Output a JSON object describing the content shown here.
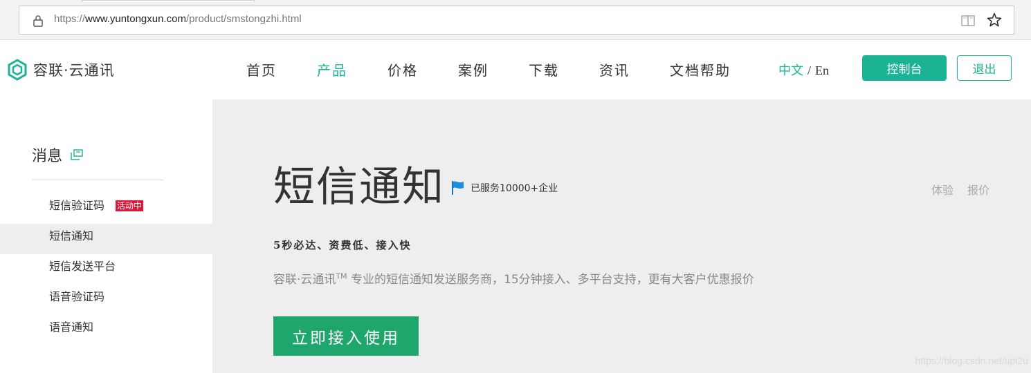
{
  "browser": {
    "url_prefix": "https://",
    "url_host": "www.yuntongxun.com",
    "url_path": "/product/smstongzhi.html"
  },
  "header": {
    "logo_text": "容联·云通讯",
    "nav": [
      {
        "label": "首页",
        "active": false
      },
      {
        "label": "产品",
        "active": true
      },
      {
        "label": "价格",
        "active": false
      },
      {
        "label": "案例",
        "active": false
      },
      {
        "label": "下载",
        "active": false
      },
      {
        "label": "资讯",
        "active": false
      },
      {
        "label": "文档帮助",
        "active": false
      }
    ],
    "lang_zh": "中文",
    "lang_sep": "/",
    "lang_en": "En",
    "console_label": "控制台",
    "logout_label": "退出"
  },
  "sidebar": {
    "title": "消息",
    "items": [
      {
        "label": "短信验证码",
        "badge": "活动中"
      },
      {
        "label": "短信通知",
        "active": true
      },
      {
        "label": "短信发送平台"
      },
      {
        "label": "语音验证码"
      },
      {
        "label": "语音通知"
      }
    ]
  },
  "hero": {
    "title": "短信通知",
    "served": "已服务10000+企业",
    "link_try": "体验",
    "link_quote": "报价",
    "tagline": "5秒必达、资费低、接入快",
    "desc_brand": "容联·云通讯",
    "desc_tm": "TM",
    "desc_rest": " 专业的短信通知发送服务商，15分钟接入、多平台支持，更有大客户优惠报价",
    "cta_label": "立即接入使用"
  },
  "watermark": "https://blog.csdn.net/upi2u",
  "colors": {
    "accent": "#1ab394",
    "cta": "#1fa66d",
    "badge": "#d9183b",
    "hero_bg": "#eeeeee"
  }
}
